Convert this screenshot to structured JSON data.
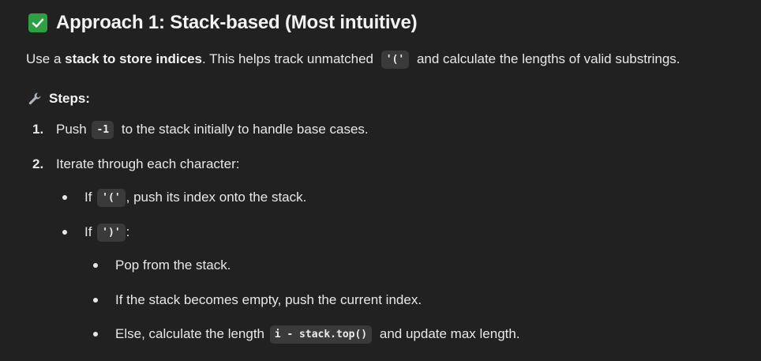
{
  "heading": {
    "check_icon": "white-check-mark-icon",
    "title": "Approach 1: Stack-based (Most intuitive)"
  },
  "intro": {
    "prefix": "Use a ",
    "bold": "stack to store indices",
    "middle": ". This helps track unmatched ",
    "code": "'('",
    "suffix": " and calculate the lengths of valid substrings."
  },
  "steps": {
    "icon": "wrench-icon",
    "title": "Steps:"
  },
  "step1": {
    "num": "1.",
    "prefix": "Push ",
    "code": "-1",
    "suffix": " to the stack initially to handle base cases."
  },
  "step2": {
    "num": "2.",
    "text": "Iterate through each character:"
  },
  "bullet_open": {
    "prefix": "If ",
    "code": "'('",
    "suffix": ", push its index onto the stack."
  },
  "bullet_close": {
    "prefix": "If ",
    "code": "')'",
    "suffix": ":"
  },
  "sub1": {
    "text": "Pop from the stack."
  },
  "sub2": {
    "text": "If the stack becomes empty, push the current index."
  },
  "sub3": {
    "prefix": "Else, calculate the length ",
    "code": "i - stack.top()",
    "suffix": " and update max length."
  }
}
